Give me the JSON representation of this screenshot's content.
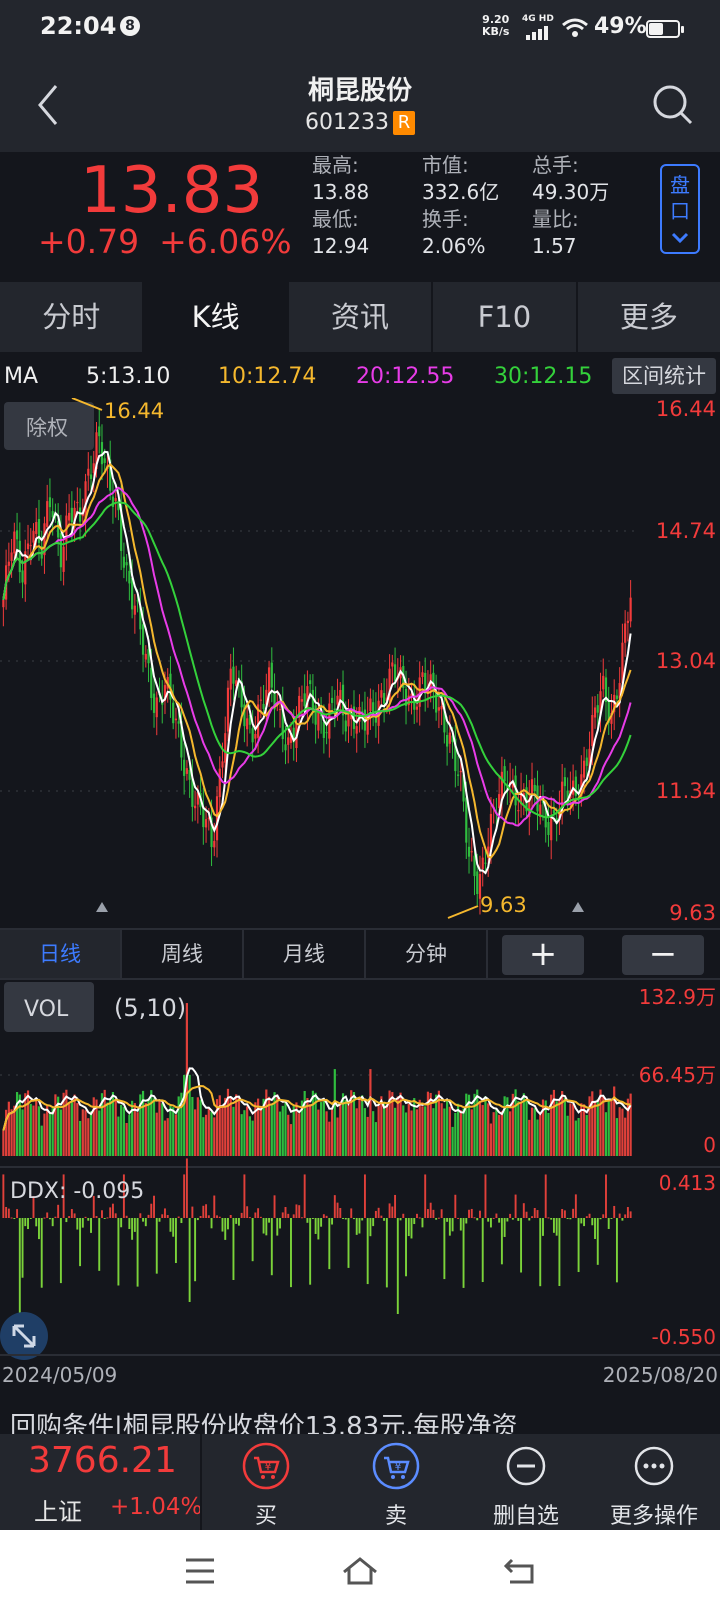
{
  "status": {
    "time": "22:04",
    "badge": "8",
    "speed_value": "9.20",
    "speed_unit": "KB/s",
    "network": "4G HD",
    "battery_percent": "49%",
    "battery_level": 0.49
  },
  "header": {
    "title": "桐昆股份",
    "code": "601233",
    "code_badge": "R"
  },
  "quote": {
    "price": "13.83",
    "change": "+0.79",
    "change_pct": "+6.06%",
    "stats": [
      {
        "label": "最高:",
        "value": "13.88"
      },
      {
        "label": "市值:",
        "value": "332.6亿"
      },
      {
        "label": "总手:",
        "value": "49.30万"
      },
      {
        "label": "最低:",
        "value": "12.94"
      },
      {
        "label": "换手:",
        "value": "2.06%"
      },
      {
        "label": "量比:",
        "value": "1.57"
      }
    ],
    "panel_button": [
      "盘",
      "口"
    ],
    "up_color": "#f23b3b"
  },
  "tabs": [
    "分时",
    "K线",
    "资讯",
    "F10",
    "更多"
  ],
  "active_tab": "K线",
  "ma": {
    "label": "MA",
    "ma5": "5:13.10",
    "ma10": "10:12.74",
    "ma20": "20:12.55",
    "ma30": "30:12.15",
    "colors": {
      "ma5": "#ffffff",
      "ma10": "#f5b82e",
      "ma20": "#e83ce8",
      "ma30": "#34d13b"
    },
    "range_button": "区间统计"
  },
  "chart_data": [
    {
      "type": "candlestick",
      "title": "",
      "y_ticks": [
        "16.44",
        "14.74",
        "13.04",
        "11.34",
        "9.63"
      ],
      "ylim": [
        9.63,
        16.44
      ],
      "x_range": [
        "2024/05/09",
        "2025/08/20"
      ],
      "max_marker": "16.44",
      "min_marker": "9.63",
      "tag": "除权",
      "close_path": [
        13.8,
        14.6,
        14.2,
        14.9,
        14.4,
        15.2,
        14.5,
        15.0,
        14.8,
        15.6,
        16.1,
        15.3,
        15.0,
        14.2,
        13.6,
        12.9,
        12.4,
        12.7,
        12.1,
        11.6,
        11.2,
        10.8,
        10.4,
        11.8,
        12.9,
        12.3,
        12.0,
        12.4,
        12.6,
        12.2,
        11.9,
        12.2,
        12.5,
        12.3,
        12.1,
        12.4,
        12.2,
        12.3,
        12.1,
        12.2,
        12.6,
        12.9,
        12.5,
        12.4,
        12.8,
        12.5,
        12.2,
        12.0,
        11.4,
        10.2,
        10.0,
        10.6,
        11.0,
        11.4,
        11.2,
        11.0,
        11.1,
        10.9,
        10.8,
        11.1,
        11.2,
        11.5,
        12.0,
        12.6,
        12.3,
        12.9,
        13.83
      ]
    },
    {
      "type": "bar",
      "title": "VOL",
      "params": "(5,10)",
      "y_ticks": [
        "132.9万",
        "66.45万",
        "0"
      ],
      "ylim": [
        0,
        132.9
      ],
      "unit": "万"
    },
    {
      "type": "bar",
      "title": "DDX",
      "value": "DDX: -0.095",
      "y_ticks": [
        "0.413",
        "-0.550"
      ],
      "ylim": [
        -0.55,
        0.413
      ],
      "x_ticks": [
        "2024/05/09",
        "2025/08/20"
      ]
    }
  ],
  "period_tabs": [
    "日线",
    "周线",
    "月线",
    "分钟"
  ],
  "zoom": {
    "in": "+",
    "out": "−"
  },
  "news": "回购条件|桐昆股份收盘价13.83元,每股净资",
  "bottom": {
    "index_value": "3766.21",
    "index_name": "上证",
    "index_change": "+1.04%",
    "buy": "买",
    "sell": "卖",
    "remove": "删自选",
    "more": "更多操作"
  }
}
